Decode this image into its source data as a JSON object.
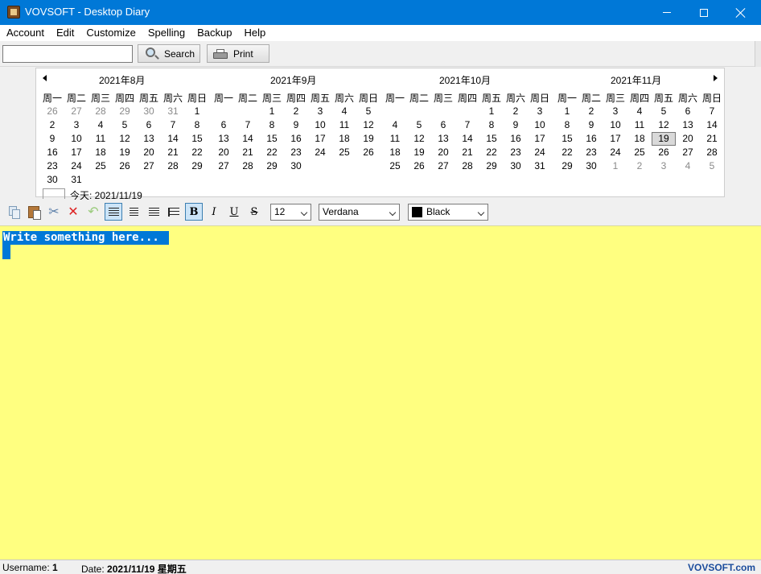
{
  "window": {
    "title": "VOVSOFT - Desktop Diary"
  },
  "menu": [
    "Account",
    "Edit",
    "Customize",
    "Spelling",
    "Backup",
    "Help"
  ],
  "search": {
    "value": "",
    "button_label": "Search",
    "print_label": "Print"
  },
  "calendar": {
    "weekdays": [
      "周一",
      "周二",
      "周三",
      "周四",
      "周五",
      "周六",
      "周日"
    ],
    "months": [
      {
        "title": "2021年8月",
        "rows": [
          [
            [
              "26",
              "g"
            ],
            [
              "27",
              "g"
            ],
            [
              "28",
              "g"
            ],
            [
              "29",
              "g"
            ],
            [
              "30",
              "g"
            ],
            [
              "31",
              "g"
            ],
            [
              "1",
              ""
            ]
          ],
          [
            [
              "2",
              ""
            ],
            [
              "3",
              ""
            ],
            [
              "4",
              ""
            ],
            [
              "5",
              ""
            ],
            [
              "6",
              ""
            ],
            [
              "7",
              ""
            ],
            [
              "8",
              ""
            ]
          ],
          [
            [
              "9",
              ""
            ],
            [
              "10",
              ""
            ],
            [
              "11",
              ""
            ],
            [
              "12",
              ""
            ],
            [
              "13",
              ""
            ],
            [
              "14",
              ""
            ],
            [
              "15",
              ""
            ]
          ],
          [
            [
              "16",
              ""
            ],
            [
              "17",
              ""
            ],
            [
              "18",
              ""
            ],
            [
              "19",
              ""
            ],
            [
              "20",
              ""
            ],
            [
              "21",
              ""
            ],
            [
              "22",
              ""
            ]
          ],
          [
            [
              "23",
              ""
            ],
            [
              "24",
              ""
            ],
            [
              "25",
              ""
            ],
            [
              "26",
              ""
            ],
            [
              "27",
              ""
            ],
            [
              "28",
              ""
            ],
            [
              "29",
              ""
            ]
          ],
          [
            [
              "30",
              ""
            ],
            [
              "31",
              ""
            ],
            null,
            null,
            null,
            null,
            null
          ]
        ]
      },
      {
        "title": "2021年9月",
        "rows": [
          [
            null,
            null,
            [
              "1",
              ""
            ],
            [
              "2",
              ""
            ],
            [
              "3",
              ""
            ],
            [
              "4",
              ""
            ],
            [
              "5",
              ""
            ]
          ],
          [
            [
              "6",
              ""
            ],
            [
              "7",
              ""
            ],
            [
              "8",
              ""
            ],
            [
              "9",
              ""
            ],
            [
              "10",
              ""
            ],
            [
              "11",
              ""
            ],
            [
              "12",
              ""
            ]
          ],
          [
            [
              "13",
              ""
            ],
            [
              "14",
              ""
            ],
            [
              "15",
              ""
            ],
            [
              "16",
              ""
            ],
            [
              "17",
              ""
            ],
            [
              "18",
              ""
            ],
            [
              "19",
              ""
            ]
          ],
          [
            [
              "20",
              ""
            ],
            [
              "21",
              ""
            ],
            [
              "22",
              ""
            ],
            [
              "23",
              ""
            ],
            [
              "24",
              ""
            ],
            [
              "25",
              ""
            ],
            [
              "26",
              ""
            ]
          ],
          [
            [
              "27",
              ""
            ],
            [
              "28",
              ""
            ],
            [
              "29",
              ""
            ],
            [
              "30",
              ""
            ],
            null,
            null,
            null
          ],
          [
            null,
            null,
            null,
            null,
            null,
            null,
            null
          ]
        ]
      },
      {
        "title": "2021年10月",
        "rows": [
          [
            null,
            null,
            null,
            null,
            [
              "1",
              ""
            ],
            [
              "2",
              ""
            ],
            [
              "3",
              ""
            ]
          ],
          [
            [
              "4",
              ""
            ],
            [
              "5",
              ""
            ],
            [
              "6",
              ""
            ],
            [
              "7",
              ""
            ],
            [
              "8",
              ""
            ],
            [
              "9",
              ""
            ],
            [
              "10",
              ""
            ]
          ],
          [
            [
              "11",
              ""
            ],
            [
              "12",
              ""
            ],
            [
              "13",
              ""
            ],
            [
              "14",
              ""
            ],
            [
              "15",
              ""
            ],
            [
              "16",
              ""
            ],
            [
              "17",
              ""
            ]
          ],
          [
            [
              "18",
              ""
            ],
            [
              "19",
              ""
            ],
            [
              "20",
              ""
            ],
            [
              "21",
              ""
            ],
            [
              "22",
              ""
            ],
            [
              "23",
              ""
            ],
            [
              "24",
              ""
            ]
          ],
          [
            [
              "25",
              ""
            ],
            [
              "26",
              ""
            ],
            [
              "27",
              ""
            ],
            [
              "28",
              ""
            ],
            [
              "29",
              ""
            ],
            [
              "30",
              ""
            ],
            [
              "31",
              ""
            ]
          ],
          [
            null,
            null,
            null,
            null,
            null,
            null,
            null
          ]
        ]
      },
      {
        "title": "2021年11月",
        "rows": [
          [
            [
              "1",
              ""
            ],
            [
              "2",
              ""
            ],
            [
              "3",
              ""
            ],
            [
              "4",
              ""
            ],
            [
              "5",
              ""
            ],
            [
              "6",
              ""
            ],
            [
              "7",
              ""
            ]
          ],
          [
            [
              "8",
              ""
            ],
            [
              "9",
              ""
            ],
            [
              "10",
              ""
            ],
            [
              "11",
              ""
            ],
            [
              "12",
              ""
            ],
            [
              "13",
              ""
            ],
            [
              "14",
              ""
            ]
          ],
          [
            [
              "15",
              ""
            ],
            [
              "16",
              ""
            ],
            [
              "17",
              ""
            ],
            [
              "18",
              ""
            ],
            [
              "19",
              "s"
            ],
            [
              "20",
              ""
            ],
            [
              "21",
              ""
            ]
          ],
          [
            [
              "22",
              ""
            ],
            [
              "23",
              ""
            ],
            [
              "24",
              ""
            ],
            [
              "25",
              ""
            ],
            [
              "26",
              ""
            ],
            [
              "27",
              ""
            ],
            [
              "28",
              ""
            ]
          ],
          [
            [
              "29",
              ""
            ],
            [
              "30",
              ""
            ],
            [
              "1",
              "g"
            ],
            [
              "2",
              "g"
            ],
            [
              "3",
              "g"
            ],
            [
              "4",
              "g"
            ],
            [
              "5",
              "g"
            ]
          ],
          [
            null,
            null,
            null,
            null,
            null,
            null,
            null
          ]
        ]
      }
    ],
    "today_label": "今天: 2021/11/19"
  },
  "format": {
    "font_size": "12",
    "font_name": "Verdana",
    "color_name": "Black",
    "color_hex": "#000000",
    "bold": "B",
    "italic": "I",
    "underline": "U",
    "strike": "S"
  },
  "editor": {
    "text": "Write something here...",
    "background": "#ffff80"
  },
  "status": {
    "username_label": "Username:",
    "username_value": "1",
    "date_label": "Date:",
    "date_value": "2021/11/19 星期五",
    "brand": "VOVSOFT.com"
  }
}
